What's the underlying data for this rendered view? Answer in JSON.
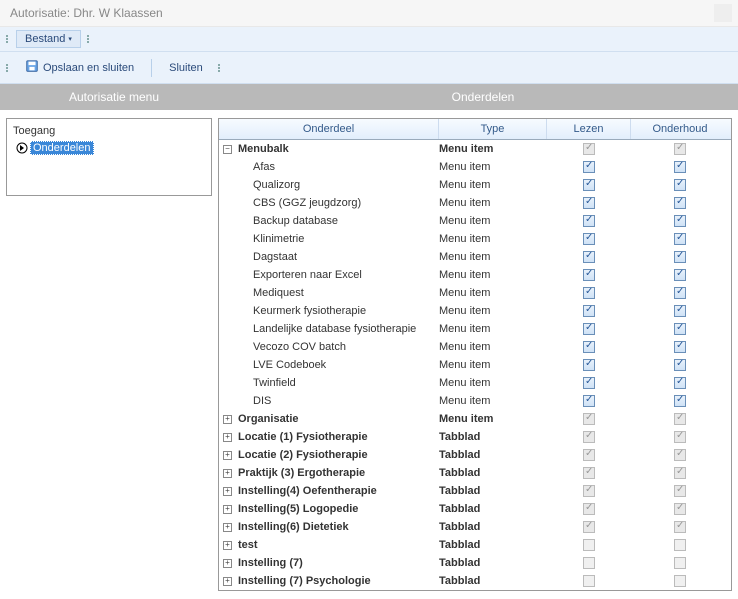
{
  "window": {
    "title": "Autorisatie: Dhr. W Klaassen"
  },
  "menu": {
    "bestand": "Bestand"
  },
  "toolbar": {
    "opslaan_sluiten": "Opslaan en sluiten",
    "sluiten": "Sluiten"
  },
  "header": {
    "left": "Autorisatie menu",
    "right": "Onderdelen"
  },
  "tree": {
    "root": "Toegang",
    "selected": "Onderdelen"
  },
  "grid": {
    "cols": {
      "onderdeel": "Onderdeel",
      "type": "Type",
      "lezen": "Lezen",
      "onderhoud": "Onderhoud"
    },
    "rows": [
      {
        "name": "Menubalk",
        "type": "Menu item",
        "lezen": "dis-checked",
        "onderhoud": "dis-checked",
        "expander": "minus",
        "bold": true
      },
      {
        "name": "Afas",
        "type": "Menu item",
        "lezen": "checked",
        "onderhoud": "checked",
        "child": true
      },
      {
        "name": "Qualizorg",
        "type": "Menu item",
        "lezen": "checked",
        "onderhoud": "checked",
        "child": true
      },
      {
        "name": "CBS (GGZ jeugdzorg)",
        "type": "Menu item",
        "lezen": "checked",
        "onderhoud": "checked",
        "child": true
      },
      {
        "name": "Backup database",
        "type": "Menu item",
        "lezen": "checked",
        "onderhoud": "checked",
        "child": true
      },
      {
        "name": "Klinimetrie",
        "type": "Menu item",
        "lezen": "checked",
        "onderhoud": "checked",
        "child": true
      },
      {
        "name": "Dagstaat",
        "type": "Menu item",
        "lezen": "checked",
        "onderhoud": "checked",
        "child": true
      },
      {
        "name": "Exporteren naar Excel",
        "type": "Menu item",
        "lezen": "checked",
        "onderhoud": "checked",
        "child": true
      },
      {
        "name": "Mediquest",
        "type": "Menu item",
        "lezen": "checked",
        "onderhoud": "checked",
        "child": true
      },
      {
        "name": "Keurmerk fysiotherapie",
        "type": "Menu item",
        "lezen": "checked",
        "onderhoud": "checked",
        "child": true
      },
      {
        "name": "Landelijke database fysiotherapie",
        "type": "Menu item",
        "lezen": "checked",
        "onderhoud": "checked",
        "child": true
      },
      {
        "name": "Vecozo COV batch",
        "type": "Menu item",
        "lezen": "checked",
        "onderhoud": "checked",
        "child": true
      },
      {
        "name": "LVE Codeboek",
        "type": "Menu item",
        "lezen": "checked",
        "onderhoud": "checked",
        "child": true
      },
      {
        "name": "Twinfield",
        "type": "Menu item",
        "lezen": "checked",
        "onderhoud": "checked",
        "child": true
      },
      {
        "name": "DIS",
        "type": "Menu item",
        "lezen": "checked",
        "onderhoud": "checked",
        "child": true
      },
      {
        "name": "Organisatie",
        "type": "Menu item",
        "lezen": "dis-checked",
        "onderhoud": "dis-checked",
        "expander": "plus",
        "bold": true
      },
      {
        "name": "Locatie (1) Fysiotherapie",
        "type": "Tabblad",
        "lezen": "dis-checked",
        "onderhoud": "dis-checked",
        "expander": "plus",
        "bold": true
      },
      {
        "name": "Locatie (2) Fysiotherapie",
        "type": "Tabblad",
        "lezen": "dis-checked",
        "onderhoud": "dis-checked",
        "expander": "plus",
        "bold": true
      },
      {
        "name": "Praktijk (3) Ergotherapie",
        "type": "Tabblad",
        "lezen": "dis-checked",
        "onderhoud": "dis-checked",
        "expander": "plus",
        "bold": true
      },
      {
        "name": "Instelling(4) Oefentherapie",
        "type": "Tabblad",
        "lezen": "dis-checked",
        "onderhoud": "dis-checked",
        "expander": "plus",
        "bold": true
      },
      {
        "name": "Instelling(5) Logopedie",
        "type": "Tabblad",
        "lezen": "dis-checked",
        "onderhoud": "dis-checked",
        "expander": "plus",
        "bold": true
      },
      {
        "name": "Instelling(6) Dietetiek",
        "type": "Tabblad",
        "lezen": "dis-checked",
        "onderhoud": "dis-checked",
        "expander": "plus",
        "bold": true
      },
      {
        "name": "test",
        "type": "Tabblad",
        "lezen": "dis",
        "onderhoud": "dis",
        "expander": "plus",
        "bold": true
      },
      {
        "name": "Instelling (7)",
        "type": "Tabblad",
        "lezen": "dis",
        "onderhoud": "dis",
        "expander": "plus",
        "bold": true
      },
      {
        "name": "Instelling (7) Psychologie",
        "type": "Tabblad",
        "lezen": "dis",
        "onderhoud": "dis",
        "expander": "plus",
        "bold": true
      }
    ]
  }
}
